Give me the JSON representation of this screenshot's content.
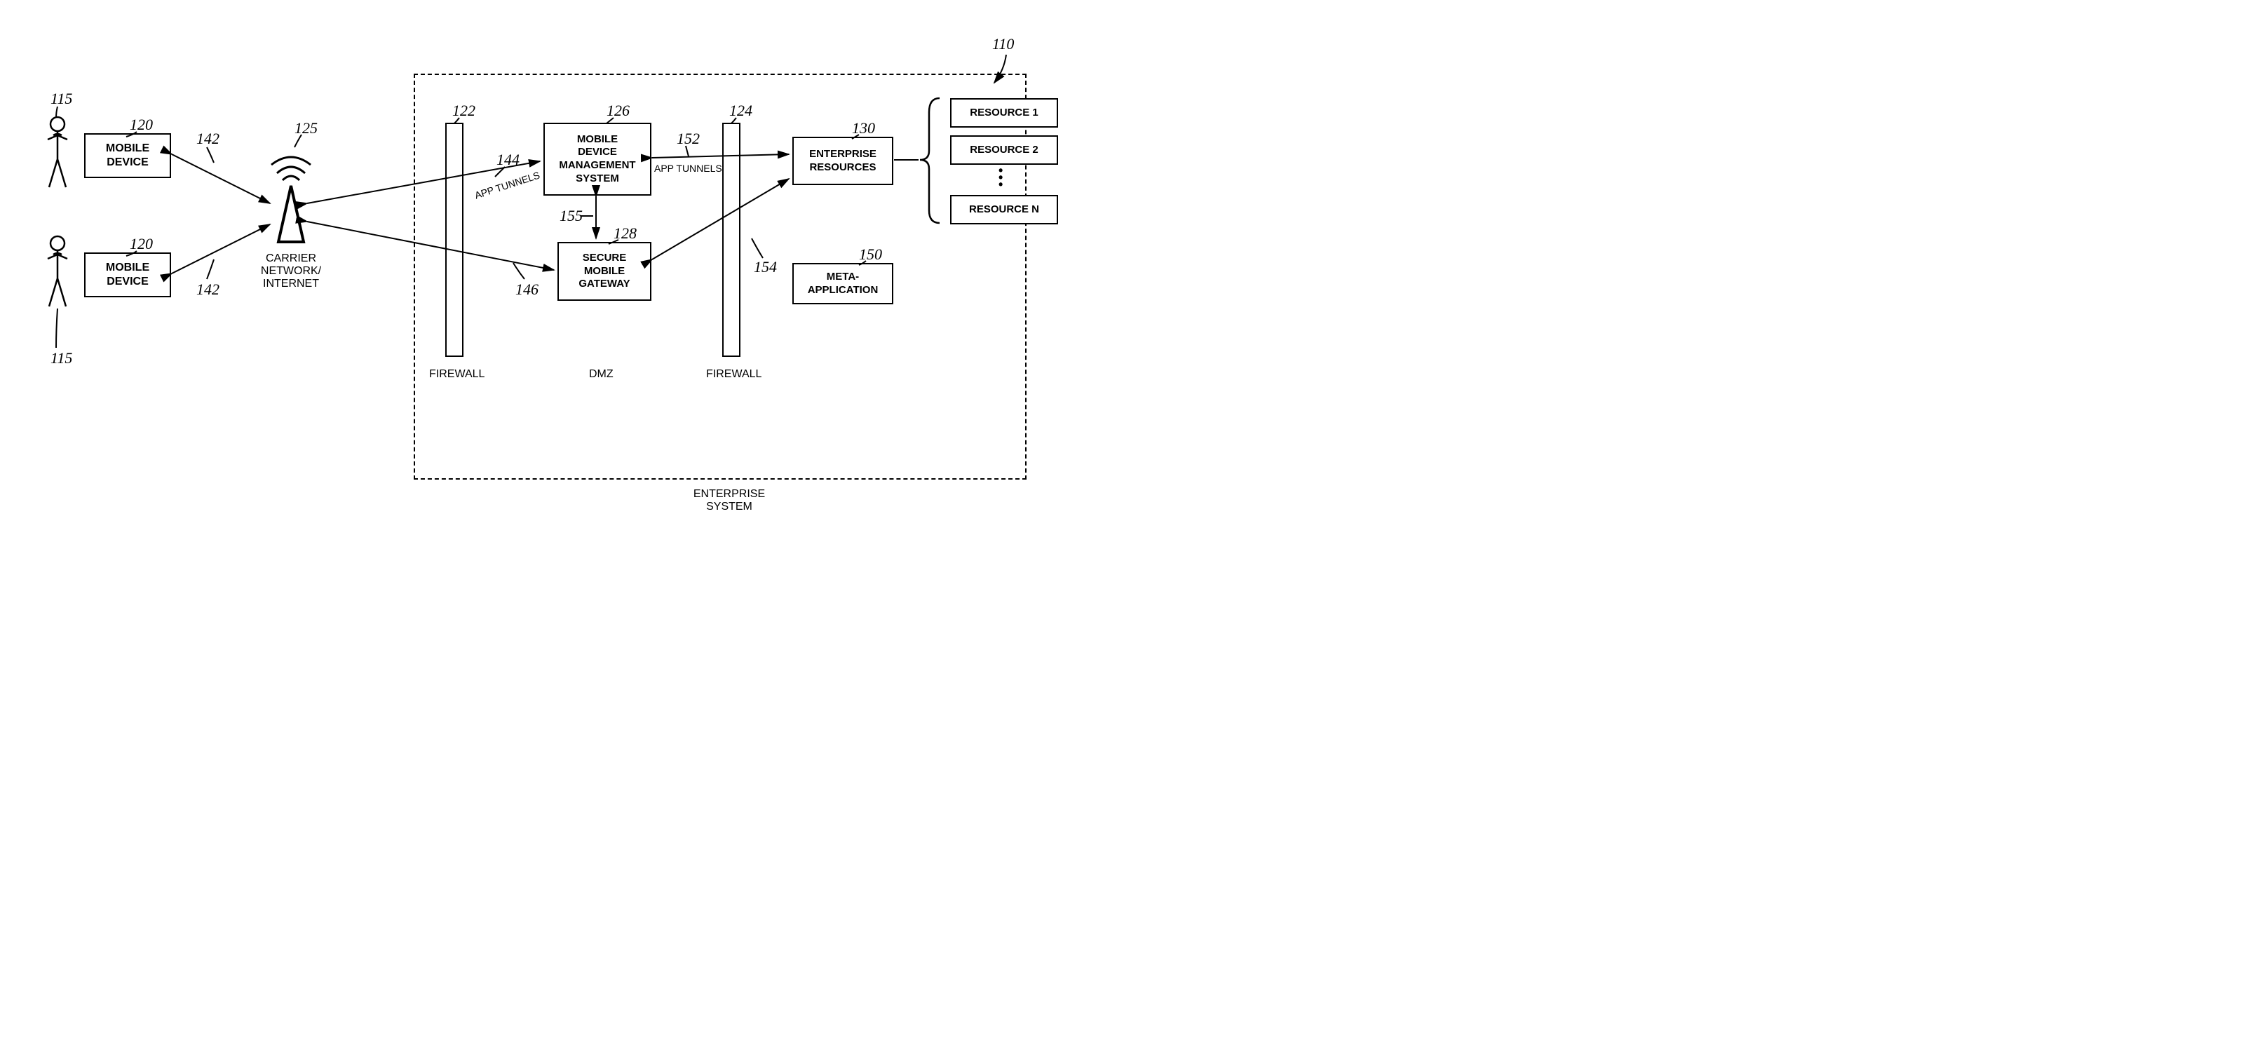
{
  "refs": {
    "system": "110",
    "user_top": "115",
    "user_bottom": "115",
    "device_top": "120",
    "device_bottom": "120",
    "tower": "125",
    "fw_left": "122",
    "fw_right": "124",
    "mdm": "126",
    "smg": "128",
    "er": "130",
    "meta": "150",
    "link_dev_top": "142",
    "link_dev_bottom": "142",
    "link_fw_mdm": "144",
    "link_fw_smg": "146",
    "link_mdm_er": "152",
    "link_smg_er": "154",
    "link_mdm_smg": "155"
  },
  "boxes": {
    "mobile_device": "MOBILE\nDEVICE",
    "carrier": "CARRIER\nNETWORK/\nINTERNET",
    "firewall": "FIREWALL",
    "mdm": "MOBILE\nDEVICE\nMANAGEMENT\nSYSTEM",
    "smg": "SECURE\nMOBILE\nGATEWAY",
    "dmz": "DMZ",
    "er": "ENTERPRISE\nRESOURCES",
    "meta": "META-\nAPPLICATION",
    "r1": "RESOURCE 1",
    "r2": "RESOURCE 2",
    "rn": "RESOURCE N",
    "app_tunnels": "APP TUNNELS",
    "enterprise_system": "ENTERPRISE\nSYSTEM"
  }
}
